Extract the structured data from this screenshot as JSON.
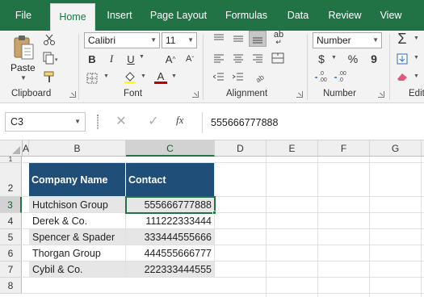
{
  "tabs": [
    "File",
    "Home",
    "Insert",
    "Page Layout",
    "Formulas",
    "Data",
    "Review",
    "View"
  ],
  "ribbon": {
    "clipboard": {
      "label": "Clipboard",
      "paste": "Paste"
    },
    "font": {
      "label": "Font",
      "name": "Calibri",
      "size": "11",
      "bold": "B",
      "italic": "I",
      "underline": "U",
      "grow": "A",
      "shrink": "A",
      "font_color_letter": "A"
    },
    "alignment": {
      "label": "Alignment",
      "wrap_glyph": "ab"
    },
    "number": {
      "label": "Number",
      "format": "Number",
      "currency": "$",
      "percent": "%",
      "comma": "9"
    },
    "editing": {
      "label": "Editi",
      "sum": "Σ"
    }
  },
  "formula_bar": {
    "name_box": "C3",
    "fx": "fx",
    "value": "555666777888"
  },
  "columns": [
    "A",
    "B",
    "C",
    "D",
    "E",
    "F",
    "G"
  ],
  "rows": [
    "1",
    "2",
    "3",
    "4",
    "5",
    "6",
    "7",
    "8"
  ],
  "table": {
    "headers": [
      "Company Name",
      "Contact"
    ],
    "rows": [
      [
        "Hutchison Group",
        "555666777888"
      ],
      [
        "Derek & Co.",
        "111222333444"
      ],
      [
        "Spencer & Spader",
        "333444555666"
      ],
      [
        "Thorgan Group",
        "444555666777"
      ],
      [
        "Cybil & Co.",
        "222333444555"
      ]
    ]
  },
  "colors": {
    "excel_green": "#217346",
    "header_fill": "#1f4e79",
    "shade_fill": "#e7e6e6"
  }
}
